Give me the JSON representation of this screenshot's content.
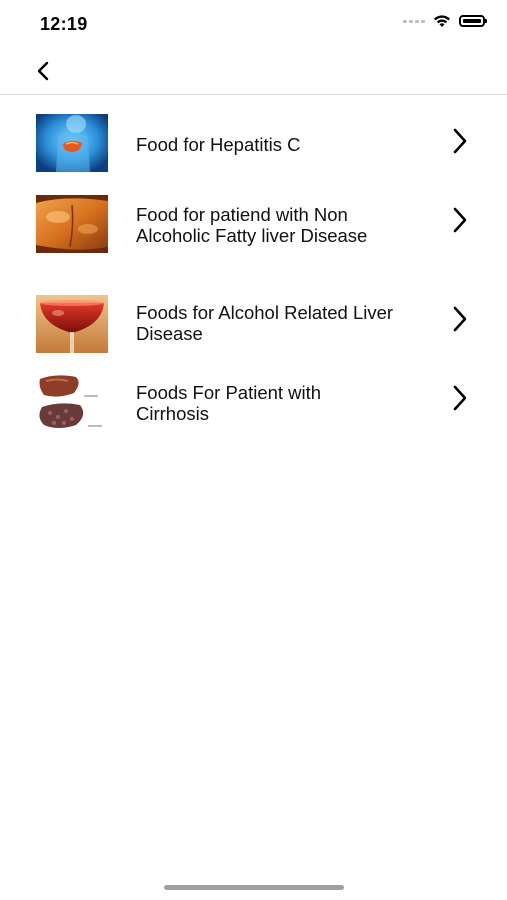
{
  "status": {
    "time": "12:19"
  },
  "nav": {
    "back_icon": "chevron-left-icon"
  },
  "list": {
    "items": [
      {
        "label": "Food for Hepatitis C",
        "image": "liver-anatomy-image"
      },
      {
        "label": "Food for patiend with Non Alcoholic Fatty liver Disease",
        "image": "fatty-liver-image"
      },
      {
        "label": "Foods for Alcohol Related Liver Disease",
        "image": "wine-glass-image"
      },
      {
        "label": "Foods For Patient with Cirrhosis",
        "image": "healthy-vs-cirrhosis-liver-image"
      }
    ]
  },
  "colors": {
    "divider": "#d9d9d9",
    "text": "#111111"
  }
}
